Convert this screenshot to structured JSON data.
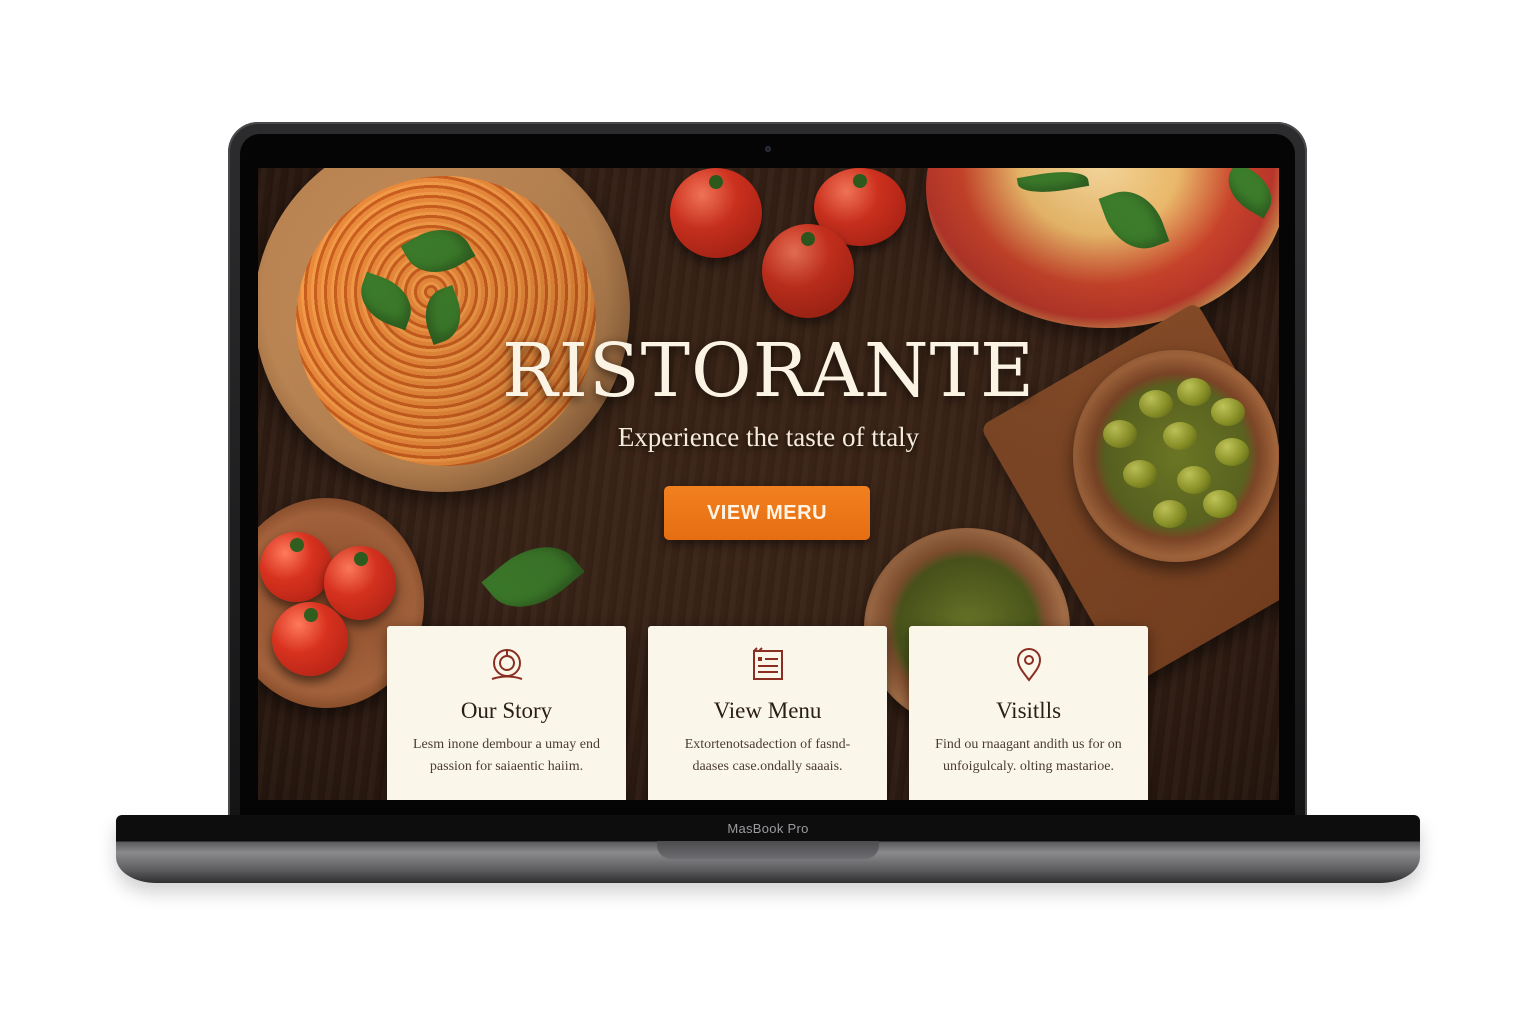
{
  "device": {
    "label": "MasBook Pro"
  },
  "hero": {
    "title": "RISTORANTE",
    "subtitle": "Experience the taste of ttaly",
    "cta_label": "VIEW MERU"
  },
  "cards": [
    {
      "icon": "plate-icon",
      "title": "Our Story",
      "text": "Lesm inone dembour a umay end passion for saiaentic haiim."
    },
    {
      "icon": "menu-list-icon",
      "title": "View Menu",
      "text": "Extortenotsadection of fasnd-daases case.ondally saaais."
    },
    {
      "icon": "location-pin-icon",
      "title": "Visitlls",
      "text": "Find ou rnaagant andith us for on unfoigulcaly. olting mastarioe."
    }
  ],
  "colors": {
    "accent": "#e8761a",
    "card_bg": "#fbf6ea",
    "background": "#3a2418",
    "heading": "#fbf3e4"
  }
}
